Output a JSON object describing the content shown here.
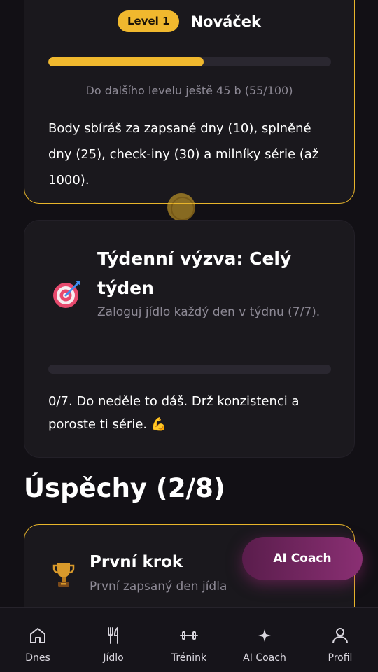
{
  "level": {
    "badge": "Level 1",
    "name": "Nováček",
    "progress": 0.55,
    "progress_note": "Do dalšího levelu ještě 45 b (55/100)",
    "description": "Body sbíráš za zapsané dny (10), splněné dny (25), check-iny (30) a milníky série (až 1000)."
  },
  "challenge": {
    "icon": "target-icon",
    "title": "Týdenní výzva: Celý týden",
    "subtitle": "Zaloguj jídlo každý den v týdnu (7/7).",
    "progress": 0,
    "note": "0/7. Do neděle to dáš. Drž konzistenci a poroste ti série. 💪"
  },
  "achievements": {
    "title": "Úspěchy (2/8)",
    "items": [
      {
        "icon": "trophy-icon",
        "title": "První krok",
        "subtitle": "První zapsaný den jídla"
      }
    ]
  },
  "ai_coach_button": "AI Coach",
  "nav": [
    {
      "label": "Dnes",
      "icon": "home-icon"
    },
    {
      "label": "Jídlo",
      "icon": "utensils-icon"
    },
    {
      "label": "Trénink",
      "icon": "dumbbell-icon"
    },
    {
      "label": "AI Coach",
      "icon": "sparkle-icon"
    },
    {
      "label": "Profil",
      "icon": "user-icon"
    }
  ],
  "colors": {
    "accent": "#f0b82e",
    "background": "#121015",
    "card": "#1b191e",
    "coach_gradient_start": "#5a1d4c",
    "coach_gradient_end": "#8a2f73"
  }
}
